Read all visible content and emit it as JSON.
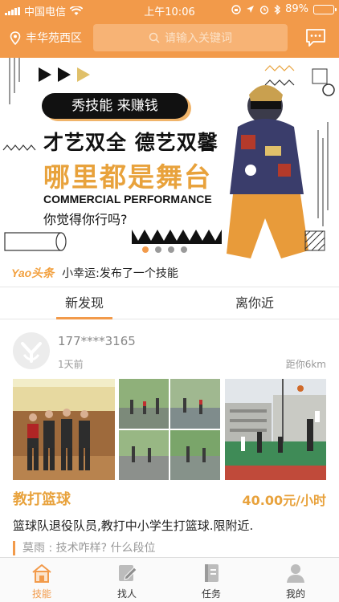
{
  "status": {
    "carrier": "中国电信",
    "time": "上午10:06",
    "battery": "89%",
    "battery_level": 0.89
  },
  "header": {
    "location": "丰华苑西区",
    "search_placeholder": "请输入关键词"
  },
  "banner": {
    "tag": "秀技能 来赚钱",
    "headline": "才艺双全 德艺双馨",
    "subheadline": "哪里都是舞台",
    "english": "COMMERCIAL PERFORMANCE",
    "question": "你觉得你行吗?",
    "pages": 4,
    "active_page": 1
  },
  "ticker": {
    "brand": "Yao头条",
    "text": "小幸运:发布了一个技能"
  },
  "tabs": [
    {
      "label": "新发现",
      "active": true
    },
    {
      "label": "离你近",
      "active": false
    }
  ],
  "post": {
    "user": "177****3165",
    "time": "1天前",
    "distance": "距你6km",
    "skill": "教打篮球",
    "price": "40.00元/小时",
    "description": "篮球队退役队员,教打中小学生打篮球.限附近.",
    "comment": "莫雨 : 技术咋样? 什么段位"
  },
  "nav": [
    {
      "label": "技能",
      "icon": "home-icon",
      "active": true
    },
    {
      "label": "找人",
      "icon": "edit-icon",
      "active": false
    },
    {
      "label": "任务",
      "icon": "book-icon",
      "active": false
    },
    {
      "label": "我的",
      "icon": "user-icon",
      "active": false
    }
  ],
  "colors": {
    "brand": "#f29a4a",
    "accent_text": "#e8a23c"
  }
}
